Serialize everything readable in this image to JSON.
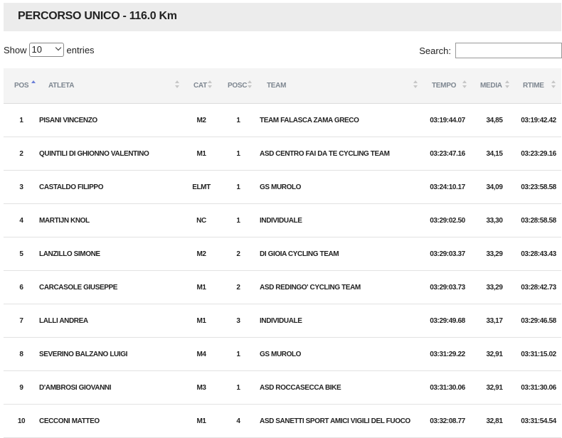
{
  "title": "PERCORSO UNICO - 116.0 Km",
  "length": {
    "show_label": "Show",
    "selected": "10",
    "entries_label": "entries"
  },
  "search": {
    "label": "Search:",
    "value": ""
  },
  "columns": {
    "pos": "POS",
    "atleta": "ATLETA",
    "cat": "CAT",
    "posc": "POSC",
    "team": "TEAM",
    "tempo": "TEMPO",
    "media": "MEDIA",
    "rtime": "RTIME"
  },
  "sort": {
    "column": "pos",
    "direction": "asc",
    "arrow_color": "#6b7fd7"
  },
  "rows": [
    {
      "pos": "1",
      "atleta": "PISANI VINCENZO",
      "cat": "M2",
      "posc": "1",
      "team": "TEAM FALASCA ZAMA GRECO",
      "tempo": "03:19:44.07",
      "media": "34,85",
      "rtime": "03:19:42.42"
    },
    {
      "pos": "2",
      "atleta": "QUINTILI DI GHIONNO VALENTINO",
      "cat": "M1",
      "posc": "1",
      "team": "ASD CENTRO FAI DA TE CYCLING TEAM",
      "tempo": "03:23:47.16",
      "media": "34,15",
      "rtime": "03:23:29.16"
    },
    {
      "pos": "3",
      "atleta": "CASTALDO FILIPPO",
      "cat": "ELMT",
      "posc": "1",
      "team": "GS MUROLO",
      "tempo": "03:24:10.17",
      "media": "34,09",
      "rtime": "03:23:58.58"
    },
    {
      "pos": "4",
      "atleta": "MARTIJN KNOL",
      "cat": "NC",
      "posc": "1",
      "team": "INDIVIDUALE",
      "tempo": "03:29:02.50",
      "media": "33,30",
      "rtime": "03:28:58.58"
    },
    {
      "pos": "5",
      "atleta": "LANZILLO SIMONE",
      "cat": "M2",
      "posc": "2",
      "team": "DI GIOIA CYCLING TEAM",
      "tempo": "03:29:03.37",
      "media": "33,29",
      "rtime": "03:28:43.43"
    },
    {
      "pos": "6",
      "atleta": "CARCASOLE GIUSEPPE",
      "cat": "M1",
      "posc": "2",
      "team": "ASD REDINGO' CYCLING TEAM",
      "tempo": "03:29:03.73",
      "media": "33,29",
      "rtime": "03:28:42.73"
    },
    {
      "pos": "7",
      "atleta": "LALLI ANDREA",
      "cat": "M1",
      "posc": "3",
      "team": "INDIVIDUALE",
      "tempo": "03:29:49.68",
      "media": "33,17",
      "rtime": "03:29:46.58"
    },
    {
      "pos": "8",
      "atleta": "SEVERINO BALZANO LUIGI",
      "cat": "M4",
      "posc": "1",
      "team": "GS MUROLO",
      "tempo": "03:31:29.22",
      "media": "32,91",
      "rtime": "03:31:15.02"
    },
    {
      "pos": "9",
      "atleta": "D'AMBROSI GIOVANNI",
      "cat": "M3",
      "posc": "1",
      "team": "ASD ROCCASECCA BIKE",
      "tempo": "03:31:30.06",
      "media": "32,91",
      "rtime": "03:31:30.06"
    },
    {
      "pos": "10",
      "atleta": "CECCONI MATTEO",
      "cat": "M1",
      "posc": "4",
      "team": "ASD SANETTI SPORT AMICI VIGILI DEL FUOCO",
      "tempo": "03:32:08.77",
      "media": "32,81",
      "rtime": "03:31:54.54"
    }
  ]
}
